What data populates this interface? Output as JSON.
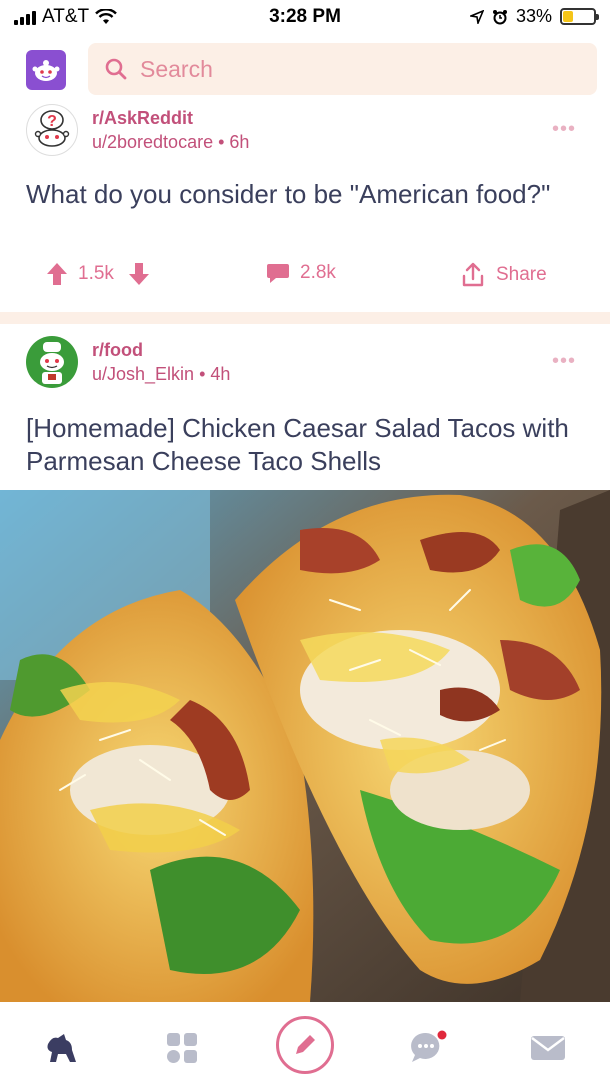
{
  "status_bar": {
    "carrier": "AT&T",
    "time": "3:28 PM",
    "battery_percent": "33%",
    "battery_level": 0.33
  },
  "search": {
    "placeholder": "Search"
  },
  "posts": [
    {
      "subreddit": "r/AskReddit",
      "author": "u/2boredtocare",
      "age": "6h",
      "title": "What do you consider to be \"American food?\"",
      "upvotes": "1.5k",
      "comments": "2.8k",
      "share_label": "Share"
    },
    {
      "subreddit": "r/food",
      "author": "u/Josh_Elkin",
      "age": "4h",
      "title": "[Homemade] Chicken Caesar Salad Tacos with Parmesan Cheese Taco Shells"
    }
  ],
  "colors": {
    "accent": "#e06e91",
    "meta": "#c2507a",
    "title": "#3a3f5c",
    "divider": "#fcefe6",
    "logo": "#8a4fd1"
  },
  "tab_bar": {
    "tabs": [
      "home-icon",
      "communities-icon",
      "create-post-icon",
      "chat-icon",
      "inbox-icon"
    ],
    "chat_has_notification": true
  }
}
